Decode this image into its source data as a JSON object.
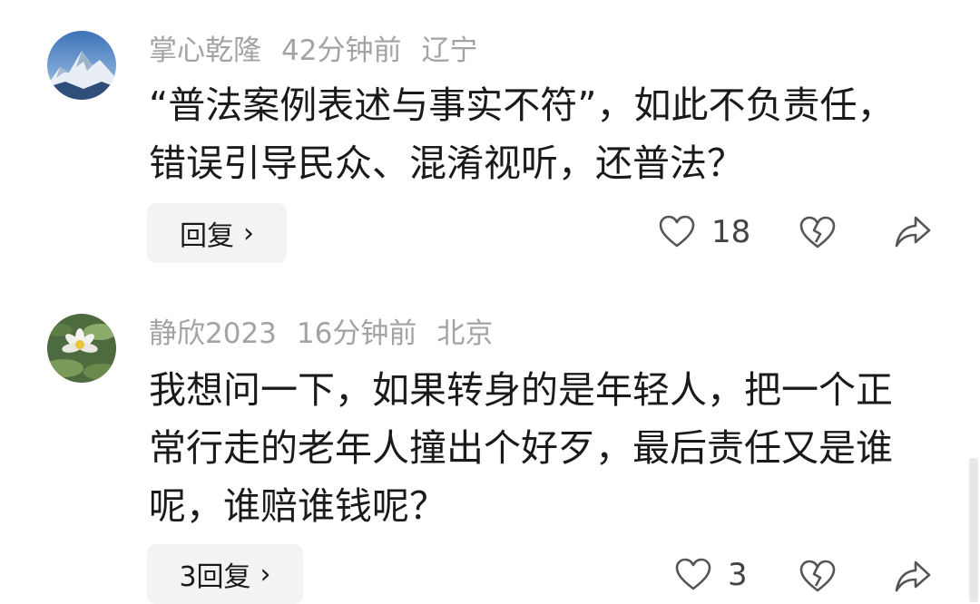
{
  "comments": [
    {
      "username": "掌心乾隆",
      "time": "42分钟前",
      "location": "辽宁",
      "text": "“普法案例表述与事实不符”，如此不负责任，错误引导民众、混淆视听，还普法？",
      "reply_label": "回复",
      "likes": "18",
      "avatar_icon": "snow-mountain-avatar"
    },
    {
      "username": "静欣2023",
      "time": "16分钟前",
      "location": "北京",
      "text": "我想问一下，如果转身的是年轻人，把一个正常行走的老年人撞出个好歹，最后责任又是谁呢，谁赔谁钱呢？",
      "reply_label": "3回复",
      "likes": "3",
      "avatar_icon": "water-lily-avatar"
    }
  ],
  "colors": {
    "meta_text": "#a3a3a3",
    "body_text": "#1a1a1a",
    "button_bg": "#f3f3f3",
    "icon_stroke": "#555555"
  }
}
